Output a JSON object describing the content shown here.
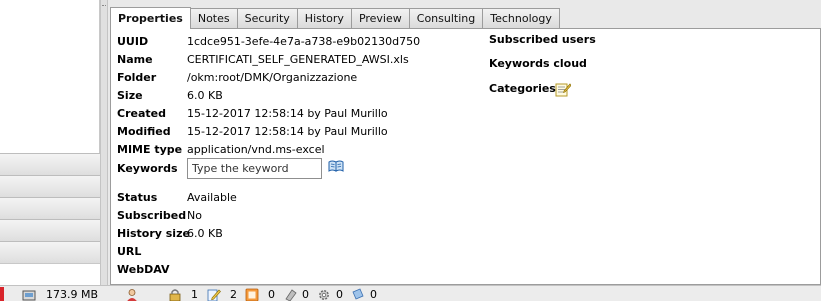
{
  "tabs": [
    {
      "label": "Properties",
      "active": true
    },
    {
      "label": "Notes",
      "active": false
    },
    {
      "label": "Security",
      "active": false
    },
    {
      "label": "History",
      "active": false
    },
    {
      "label": "Preview",
      "active": false
    },
    {
      "label": "Consulting",
      "active": false
    },
    {
      "label": "Technology",
      "active": false
    }
  ],
  "properties": {
    "uuid_label": "UUID",
    "uuid": "1cdce951-3efe-4e7a-a738-e9b02130d750",
    "name_label": "Name",
    "name": "CERTIFICATI_SELF_GENERATED_AWSI.xls",
    "folder_label": "Folder",
    "folder": "/okm:root/DMK/Organizzazione",
    "size_label": "Size",
    "size": "6.0 KB",
    "created_label": "Created",
    "created": "15-12-2017 12:58:14 by Paul Murillo",
    "modified_label": "Modified",
    "modified": "15-12-2017 12:58:14 by Paul Murillo",
    "mime_label": "MIME type",
    "mime": "application/vnd.ms-excel",
    "keywords_label": "Keywords",
    "keywords_placeholder": "Type the keyword",
    "status_label": "Status",
    "status": "Available",
    "subscribed_label": "Subscribed",
    "subscribed": "No",
    "history_size_label": "History size",
    "history_size": "6.0 KB",
    "url_label": "URL",
    "url": "",
    "webdav_label": "WebDAV",
    "webdav": ""
  },
  "right_panel": {
    "subscribed_users": "Subscribed users",
    "keywords_cloud": "Keywords cloud",
    "categories": "Categories"
  },
  "statusbar": {
    "memory": "173.9 MB",
    "locked": "1",
    "checkout": "2",
    "subscribed": "0",
    "news": "0",
    "workflows": "0",
    "messages": "0"
  },
  "colors": {
    "tab_border": "#9c9c9c",
    "content_bg": "#ffffff",
    "status_red": "#d8232a"
  }
}
